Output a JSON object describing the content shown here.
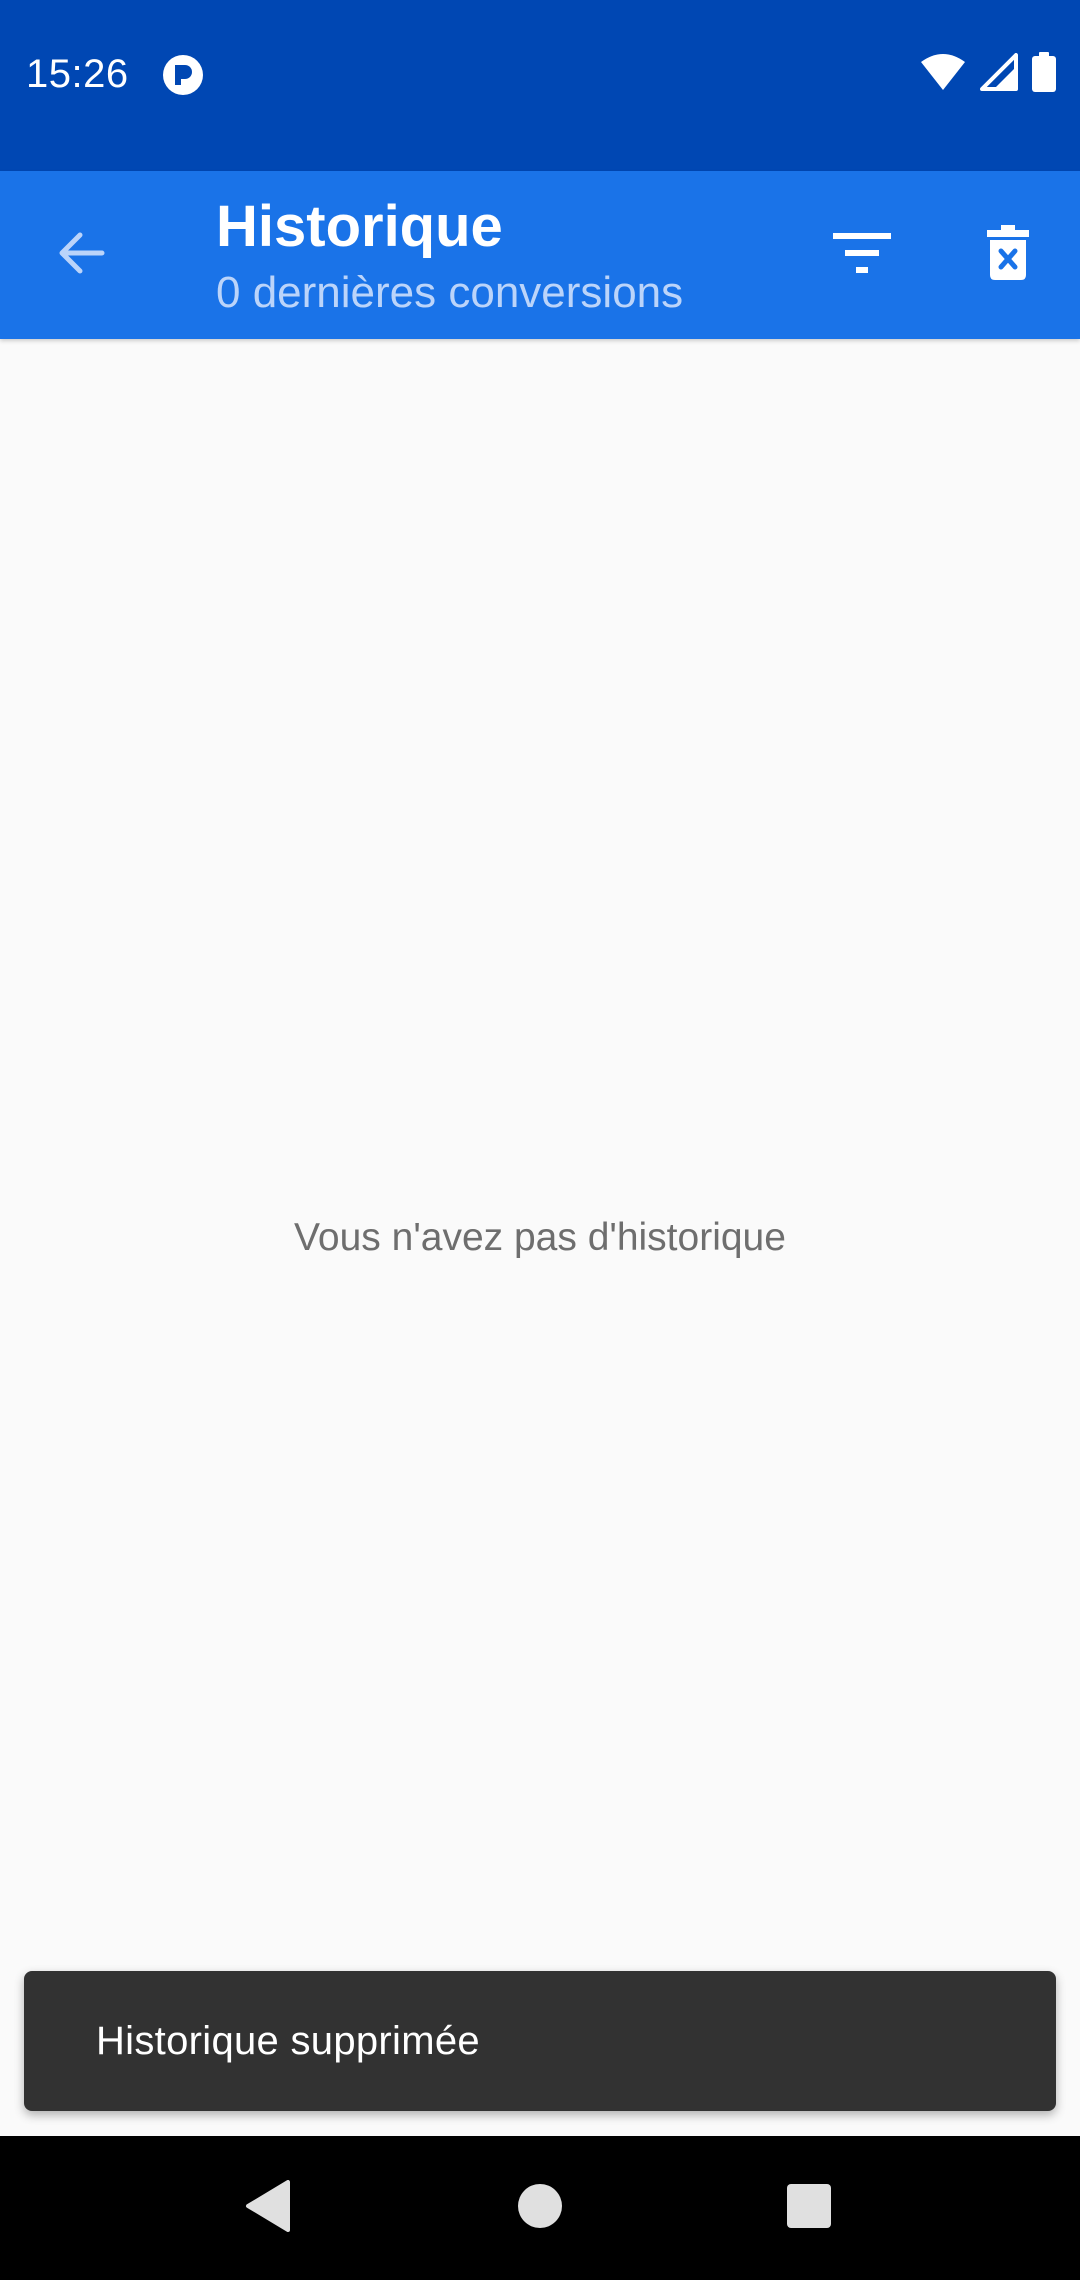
{
  "status_bar": {
    "time": "15:26"
  },
  "app_bar": {
    "title": "Historique",
    "subtitle": "0 dernières conversions"
  },
  "main": {
    "empty_message": "Vous n'avez pas d'historique"
  },
  "snackbar": {
    "message": "Historique supprimée"
  },
  "colors": {
    "status_bar": "#0047B3",
    "app_bar": "#1A73E8",
    "subtitle": "#BBD4FA",
    "background": "#FAFAFA",
    "empty_text": "#6E6E6E",
    "snackbar": "#323232",
    "nav_bar": "#000000"
  }
}
